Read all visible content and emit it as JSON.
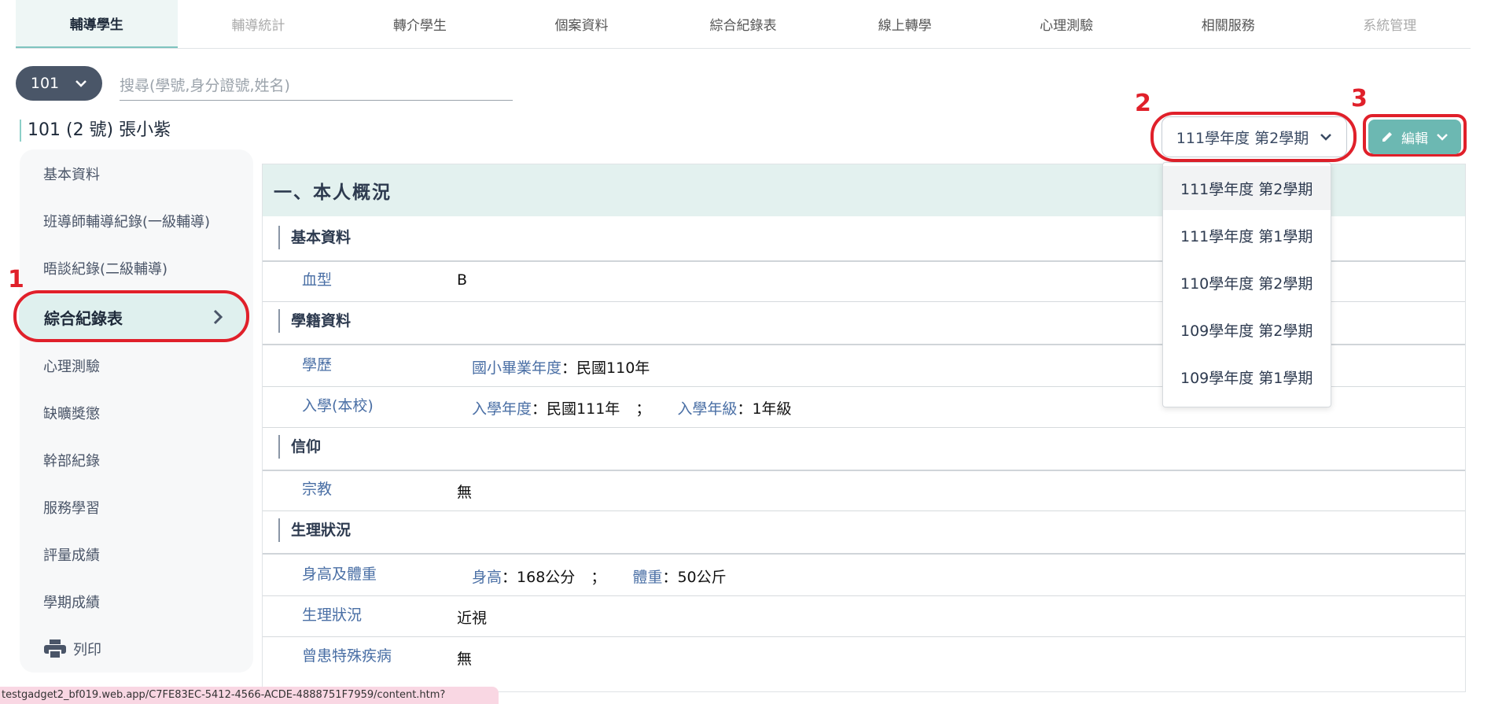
{
  "topnav": [
    "輔導學生",
    "輔導統計",
    "轉介學生",
    "個案資料",
    "綜合紀錄表",
    "線上轉學",
    "心理測驗",
    "相關服務",
    "系統管理"
  ],
  "class_select": "101",
  "search_placeholder": "搜尋(學號,身分證號,姓名)",
  "student_title": "101 (2 號) 張小紫",
  "sidebar": [
    "基本資料",
    "班導師輔導紀錄(一級輔導)",
    "晤談紀錄(二級輔導)",
    "綜合紀錄表",
    "心理測驗",
    "缺曠獎懲",
    "幹部紀錄",
    "服務學習",
    "評量成績",
    "學期成績",
    "列印"
  ],
  "semester_selected": "111學年度 第2學期",
  "edit_label": "編輯",
  "semester_options": [
    "111學年度 第2學期",
    "111學年度 第1學期",
    "110學年度 第2學期",
    "109學年度 第2學期",
    "109學年度 第1學期"
  ],
  "annotations": [
    "1",
    "2",
    "3"
  ],
  "section_title": "一、本人概況",
  "basic": {
    "head": "基本資料",
    "blood_label": "血型",
    "blood_value": "B"
  },
  "school": {
    "head": "學籍資料",
    "edu_label": "學歷",
    "edu_key": "國小畢業年度",
    "edu_value": "民國110年",
    "enroll_label": "入學(本校)",
    "enroll_year_key": "入學年度",
    "enroll_year": "民國111年",
    "sep": "；",
    "enroll_grade_key": "入學年級",
    "enroll_grade": "1年級"
  },
  "faith": {
    "head": "信仰",
    "religion_label": "宗教",
    "religion_value": "無"
  },
  "physical": {
    "head": "生理狀況",
    "hw_label": "身高及體重",
    "height_key": "身高",
    "height_value": "168公分",
    "weight_key": "體重",
    "weight_value": "50公斤",
    "cond_label": "生理狀況",
    "cond_value": "近視",
    "disease_label": "曾患特殊疾病",
    "disease_value": "無"
  },
  "colon": "：",
  "status_url": "testgadget2_bf019.web.app/C7FE83EC-5412-4566-ACDE-4888751F7959/content.htm?"
}
